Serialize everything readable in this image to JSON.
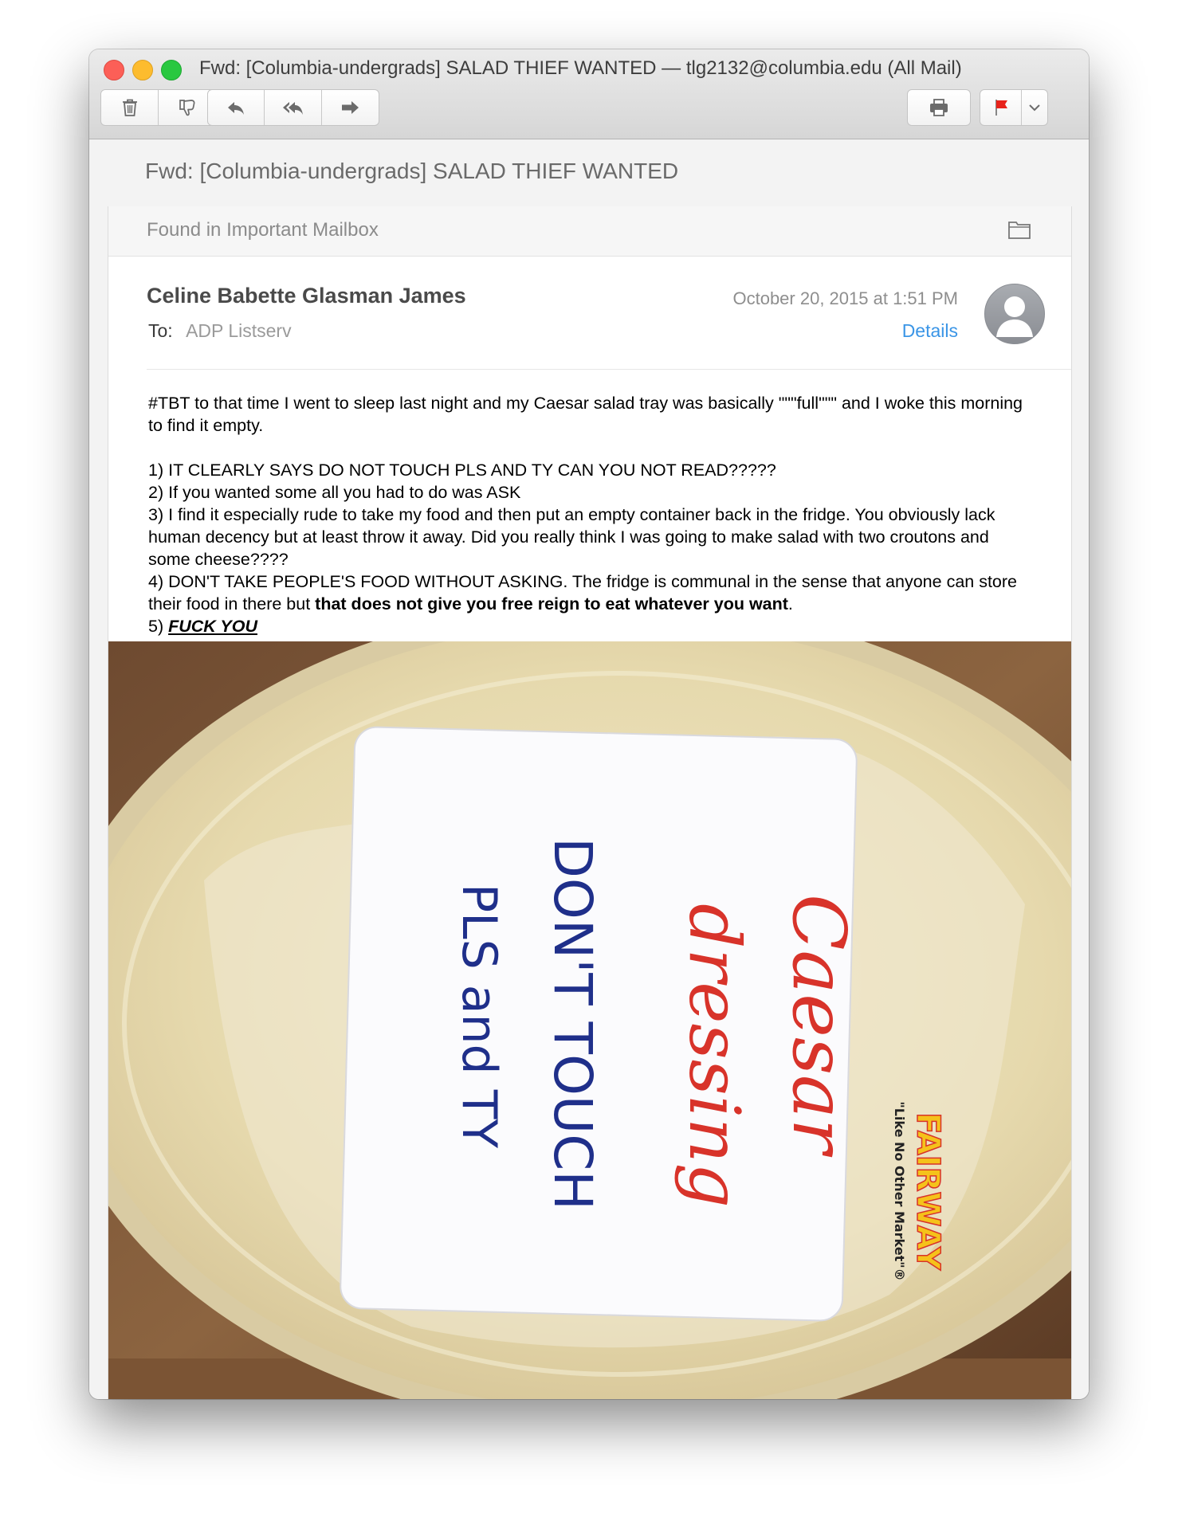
{
  "window": {
    "title": "Fwd: [Columbia-undergrads] SALAD THIEF WANTED — tlg2132@columbia.edu (All Mail)"
  },
  "toolbar": {
    "icons": [
      "trash-icon",
      "junk-thumbs-down-icon",
      "reply-icon",
      "reply-all-icon",
      "forward-icon",
      "print-icon",
      "flag-icon",
      "chevron-down-icon"
    ],
    "flag_color": "#e8231b"
  },
  "message": {
    "subject": "Fwd: [Columbia-undergrads] SALAD THIEF WANTED",
    "mailbox_banner": "Found in Important Mailbox",
    "sender": "Celine Babette Glasman James",
    "to_label": "To:",
    "to_value": "ADP Listserv",
    "date": "October 20, 2015 at 1:51 PM",
    "details_link": "Details",
    "body": {
      "intro": "#TBT to that time I went to sleep last night and my Caesar salad tray was basically \"\"\"full\"\"\" and I woke this morning to find it empty.",
      "item1": "1) IT CLEARLY SAYS DO NOT TOUCH PLS AND TY CAN YOU NOT READ?????",
      "item2": "2) If you wanted some all you had to do was ASK",
      "item3": "3) I find it especially rude to take my food and then put an empty container back in the fridge. You obviously lack human decency but at least throw it away. Did you really think I was going to make salad with two croutons and some cheese????",
      "item4_plain": "4) DON'T TAKE PEOPLE'S FOOD WITHOUT ASKING. The fridge is communal in the sense that anyone can store their food in there but ",
      "item4_bold": "that does not give you free reign to eat whatever you want",
      "item4_end": ".",
      "item5_prefix": "5) ",
      "item5_emph": "FUCK YOU"
    },
    "attachment": {
      "label_line1": "Caesar",
      "label_line2": "dressing",
      "label_line3": "DON'T TOUCH",
      "label_line4": "PLS and TY",
      "brand": "FAIRWAY",
      "brand_tagline": "\"Like No Other Market\"®"
    }
  },
  "colors": {
    "link": "#3a95e6",
    "red_marker": "#d8332a",
    "blue_marker": "#1f2f8a"
  }
}
